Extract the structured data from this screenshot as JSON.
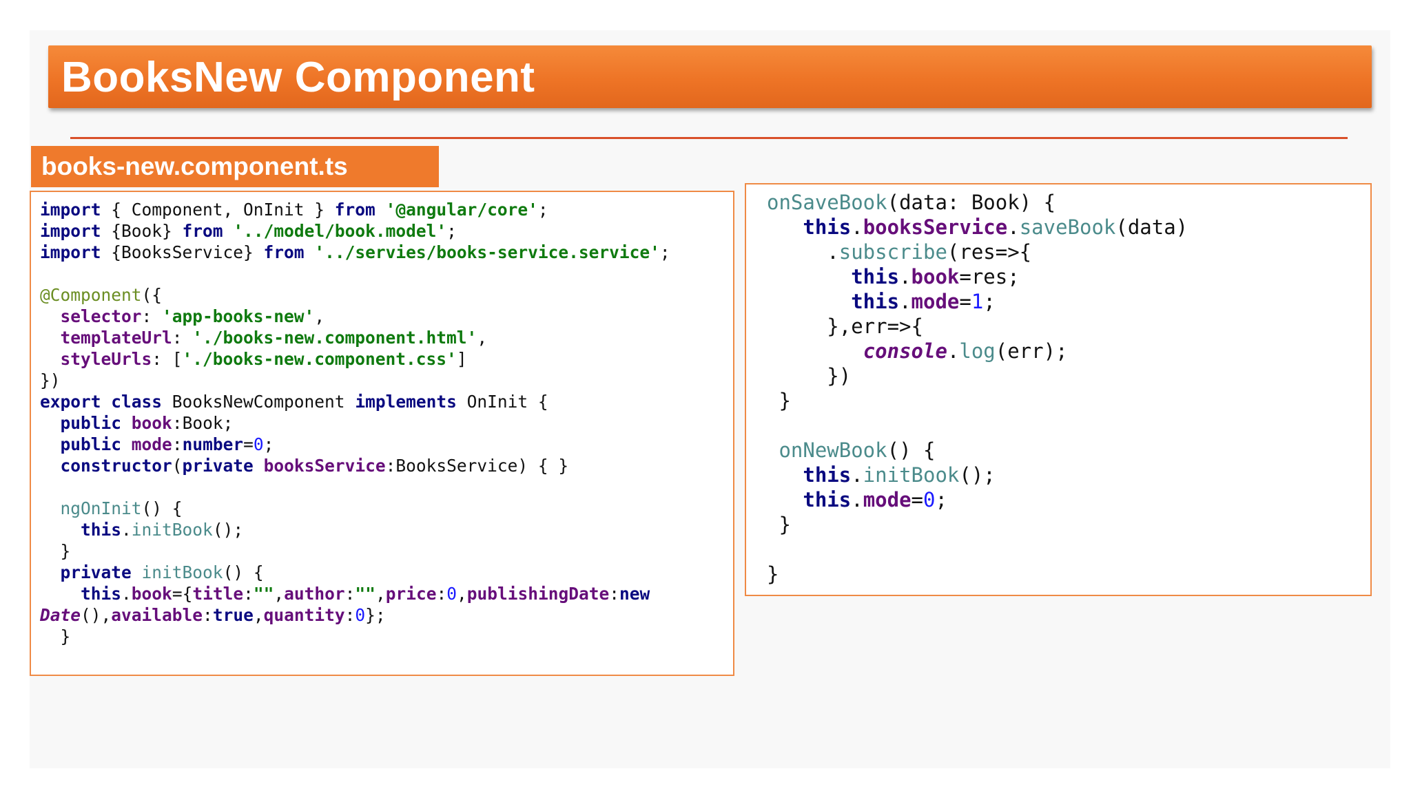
{
  "slide": {
    "title": "BooksNew Component",
    "file_tab": "books-new.component.ts",
    "colors": {
      "title_bar": "#ee7426",
      "divider": "#d9502a",
      "box_border": "#ef8a45"
    }
  },
  "code_left": [
    [
      [
        "kw",
        "import"
      ],
      [
        "t",
        " { Component, OnInit } "
      ],
      [
        "kw",
        "from"
      ],
      [
        "t",
        " "
      ],
      [
        "str",
        "'@angular/core'"
      ],
      [
        "t",
        ";"
      ]
    ],
    [
      [
        "kw",
        "import"
      ],
      [
        "t",
        " {Book} "
      ],
      [
        "kw",
        "from"
      ],
      [
        "t",
        " "
      ],
      [
        "str",
        "'../model/book.model'"
      ],
      [
        "t",
        ";"
      ]
    ],
    [
      [
        "kw",
        "import"
      ],
      [
        "t",
        " {BooksService} "
      ],
      [
        "kw",
        "from"
      ],
      [
        "t",
        " "
      ],
      [
        "str",
        "'../servies/books-service.service'"
      ],
      [
        "t",
        ";"
      ]
    ],
    [],
    [
      [
        "ann",
        "@Component"
      ],
      [
        "t",
        "({"
      ]
    ],
    [
      [
        "t",
        "  "
      ],
      [
        "prop",
        "selector"
      ],
      [
        "t",
        ": "
      ],
      [
        "str",
        "'app-books-new'"
      ],
      [
        "t",
        ","
      ]
    ],
    [
      [
        "t",
        "  "
      ],
      [
        "prop",
        "templateUrl"
      ],
      [
        "t",
        ": "
      ],
      [
        "str",
        "'./books-new.component.html'"
      ],
      [
        "t",
        ","
      ]
    ],
    [
      [
        "t",
        "  "
      ],
      [
        "prop",
        "styleUrls"
      ],
      [
        "t",
        ": ["
      ],
      [
        "str",
        "'./books-new.component.css'"
      ],
      [
        "t",
        "]"
      ]
    ],
    [
      [
        "t",
        "})"
      ]
    ],
    [
      [
        "kw",
        "export"
      ],
      [
        "t",
        " "
      ],
      [
        "kw",
        "class"
      ],
      [
        "t",
        " BooksNewComponent "
      ],
      [
        "kw",
        "implements"
      ],
      [
        "t",
        " OnInit {"
      ]
    ],
    [
      [
        "t",
        "  "
      ],
      [
        "kw",
        "public"
      ],
      [
        "t",
        " "
      ],
      [
        "prop",
        "book"
      ],
      [
        "t",
        ":Book;"
      ]
    ],
    [
      [
        "t",
        "  "
      ],
      [
        "kw",
        "public"
      ],
      [
        "t",
        " "
      ],
      [
        "prop",
        "mode"
      ],
      [
        "t",
        ":"
      ],
      [
        "kw",
        "number"
      ],
      [
        "t",
        "="
      ],
      [
        "num",
        "0"
      ],
      [
        "t",
        ";"
      ]
    ],
    [
      [
        "t",
        "  "
      ],
      [
        "kw",
        "constructor"
      ],
      [
        "t",
        "("
      ],
      [
        "kw",
        "private"
      ],
      [
        "t",
        " "
      ],
      [
        "prop",
        "booksService"
      ],
      [
        "t",
        ":BooksService) { }"
      ]
    ],
    [],
    [
      [
        "t",
        "  "
      ],
      [
        "fn",
        "ngOnInit"
      ],
      [
        "t",
        "() {"
      ]
    ],
    [
      [
        "t",
        "    "
      ],
      [
        "kw",
        "this"
      ],
      [
        "t",
        "."
      ],
      [
        "fn",
        "initBook"
      ],
      [
        "t",
        "();"
      ]
    ],
    [
      [
        "t",
        "  }"
      ]
    ],
    [
      [
        "t",
        "  "
      ],
      [
        "kw",
        "private"
      ],
      [
        "t",
        " "
      ],
      [
        "fn",
        "initBook"
      ],
      [
        "t",
        "() {"
      ]
    ],
    [
      [
        "t",
        "    "
      ],
      [
        "kw",
        "this"
      ],
      [
        "t",
        "."
      ],
      [
        "prop",
        "book"
      ],
      [
        "t",
        "={"
      ],
      [
        "prop",
        "title"
      ],
      [
        "t",
        ":"
      ],
      [
        "str",
        "\"\""
      ],
      [
        "t",
        ","
      ],
      [
        "prop",
        "author"
      ],
      [
        "t",
        ":"
      ],
      [
        "str",
        "\"\""
      ],
      [
        "t",
        ","
      ],
      [
        "prop",
        "price"
      ],
      [
        "t",
        ":"
      ],
      [
        "num",
        "0"
      ],
      [
        "t",
        ","
      ],
      [
        "prop",
        "publishingDate"
      ],
      [
        "t",
        ":"
      ],
      [
        "kw",
        "new"
      ]
    ],
    [
      [
        "cls",
        "Date"
      ],
      [
        "t",
        "(),"
      ],
      [
        "prop",
        "available"
      ],
      [
        "t",
        ":"
      ],
      [
        "kw",
        "true"
      ],
      [
        "t",
        ","
      ],
      [
        "prop",
        "quantity"
      ],
      [
        "t",
        ":"
      ],
      [
        "num",
        "0"
      ],
      [
        "t",
        "};"
      ]
    ],
    [
      [
        "t",
        "  }"
      ]
    ]
  ],
  "code_right": [
    [
      [
        "fn",
        "onSaveBook"
      ],
      [
        "t",
        "(data: Book) {"
      ]
    ],
    [
      [
        "t",
        "   "
      ],
      [
        "kw",
        "this"
      ],
      [
        "t",
        "."
      ],
      [
        "prop",
        "booksService"
      ],
      [
        "t",
        "."
      ],
      [
        "fn",
        "saveBook"
      ],
      [
        "t",
        "(data)"
      ]
    ],
    [
      [
        "t",
        "     ."
      ],
      [
        "fn",
        "subscribe"
      ],
      [
        "t",
        "(res=>{"
      ]
    ],
    [
      [
        "t",
        "       "
      ],
      [
        "kw",
        "this"
      ],
      [
        "t",
        "."
      ],
      [
        "prop",
        "book"
      ],
      [
        "t",
        "=res;"
      ]
    ],
    [
      [
        "t",
        "       "
      ],
      [
        "kw",
        "this"
      ],
      [
        "t",
        "."
      ],
      [
        "prop",
        "mode"
      ],
      [
        "t",
        "="
      ],
      [
        "num",
        "1"
      ],
      [
        "t",
        ";"
      ]
    ],
    [
      [
        "t",
        "     },err=>{"
      ]
    ],
    [
      [
        "t",
        "        "
      ],
      [
        "cls",
        "console"
      ],
      [
        "t",
        "."
      ],
      [
        "fn",
        "log"
      ],
      [
        "t",
        "(err);"
      ]
    ],
    [
      [
        "t",
        "     })"
      ]
    ],
    [
      [
        "t",
        " }"
      ]
    ],
    [],
    [
      [
        "t",
        " "
      ],
      [
        "fn",
        "onNewBook"
      ],
      [
        "t",
        "() {"
      ]
    ],
    [
      [
        "t",
        "   "
      ],
      [
        "kw",
        "this"
      ],
      [
        "t",
        "."
      ],
      [
        "fn",
        "initBook"
      ],
      [
        "t",
        "();"
      ]
    ],
    [
      [
        "t",
        "   "
      ],
      [
        "kw",
        "this"
      ],
      [
        "t",
        "."
      ],
      [
        "prop",
        "mode"
      ],
      [
        "t",
        "="
      ],
      [
        "num",
        "0"
      ],
      [
        "t",
        ";"
      ]
    ],
    [
      [
        "t",
        " }"
      ]
    ],
    [],
    [
      [
        "t",
        "}"
      ]
    ]
  ]
}
